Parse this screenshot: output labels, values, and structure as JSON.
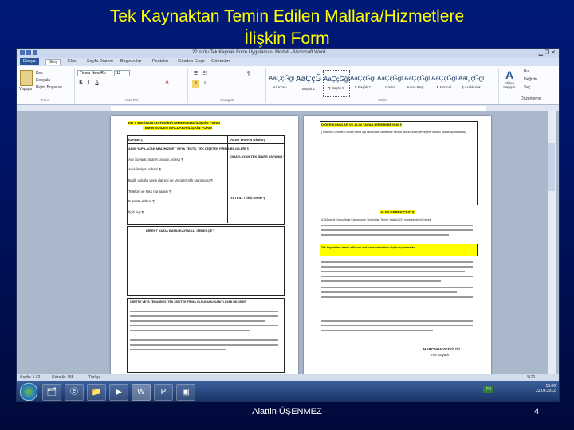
{
  "slide": {
    "title_line1": "Tek Kaynaktan Temin Edilen Mallara/Hizmetlere",
    "title_line2": "İlişkin Form",
    "author": "Alattin ÜŞENMEZ",
    "page_number": "4"
  },
  "word": {
    "window_title": "22 no'lu Tek Kaynak Form Uygulaması Modeli - Microsoft Word",
    "tabs": [
      "Dosya",
      "Giriş",
      "Ekle",
      "Sayfa Düzeni",
      "Başvurular",
      "Postalar",
      "Gözden Geçir",
      "Görünüm"
    ],
    "ribbon": {
      "paste_label": "Yapıştır",
      "cut_label": "Kes",
      "copy_label": "Kopyala",
      "format_painter_label": "Biçim Boyacısı",
      "clipboard_group": "Pano",
      "font_name": "Times New Ro",
      "font_size": "12",
      "bold": "K",
      "italic": "T",
      "underline": "A",
      "font_group": "Yazı Tipi",
      "paragraph_group": "Paragraf",
      "styles": [
        {
          "sample": "AaÇçĞğl",
          "name": "Alt Konu..."
        },
        {
          "sample": "AaÇçĞ",
          "name": "Başlık 1"
        },
        {
          "sample": "AaÇçĞğl",
          "name": "¶ Başlık 5"
        },
        {
          "sample": "AaÇçĞğl",
          "name": "¶ Başlık 7"
        },
        {
          "sample": "AaÇçĞğl",
          "name": "Güçlü"
        },
        {
          "sample": "AaÇçĞğl",
          "name": "Konu Başl..."
        },
        {
          "sample": "AaÇçĞğl",
          "name": "¶ Normal"
        },
        {
          "sample": "AaÇçĞğl",
          "name": "¶ Aralık Yok"
        }
      ],
      "styles_group": "Stiller",
      "change_styles_label": "Stilleri Değiştir",
      "find_label": "Bul",
      "replace_label": "Değiştir",
      "select_label": "Seç",
      "editing_group": "Düzenleme"
    },
    "doc": {
      "p1_heading": "EK-1 DOĞRUDAN TEMİN/HİZMETLERE İLİŞKİN FORM",
      "p1_heading2": "TEMİN EDİLEN MALLARA İLİŞKİN FORM",
      "idare_label": "İDARE ¶",
      "alim_label": "ALIM YAPAN BİRİM¶",
      "row1": "ALIM YAPILACAK MAL/HİZMET VEYA TESTİL TEK KİŞİ/TEK FİRMA BİLGİLERİ ¶",
      "row2": "Adı Soyadı, ticaret unvanı, varsa ¶",
      "row3": "Açık iletişim adresi ¶",
      "row4": "Bağlı olduğu vergi dairesi ve Vergi Kimlik Numarası ¶",
      "row5": "Telefon ve faks numarası ¶",
      "row6": "E-posta adresi ¶",
      "row7": "İlgili kişi ¶",
      "onaylayan": "ONAYLAYAN TEK İDARE YAPANIN ¶",
      "yetki": "YETKİLİ TÜRÜ BİRİM ¶",
      "section2": "DİREKT YA DA KAMU KAYNAKLI GEREKÇE ¶",
      "section3": "ÜRETİCİ VEYA TEDARİKÇİ, TEK KİŞİ/TEK FİRMA OLDUĞUNU KANITLAYAN BİLGİLER",
      "p2_heading": "DİĞER KONULAR VE ALIM YAPAN BİRİMİN BEYANI ¶",
      "p2_text1": "(Tedarikçi ürünlerin birden fazla kişi tarafından üretilebilir olması durumunda gerekçeler detaylı olarak açıklanacak)",
      "p2_box": "ALIM GEREKÇESİ ¶",
      "p2_text2": "4734 sayılı Kamu İhale Kanununun 'Doğrudan Temin' başlıklı 22. maddesinin (a) bendi",
      "p2_hl": "Tek kaynaktan temin edilecek mal veya hizmetlere ilişkin açıklamalar",
      "p2_sign": "HARCAMA YETKİLİSİ",
      "p2_sign2": "Adı Soyadı"
    },
    "status": {
      "page": "Sayfa: 1 / 2",
      "words": "Sözcük: 455",
      "language": "Türkçe",
      "zoom": "%70"
    },
    "taskbar": {
      "lang": "TR",
      "time": "13:06",
      "date": "22.06.2012"
    }
  }
}
